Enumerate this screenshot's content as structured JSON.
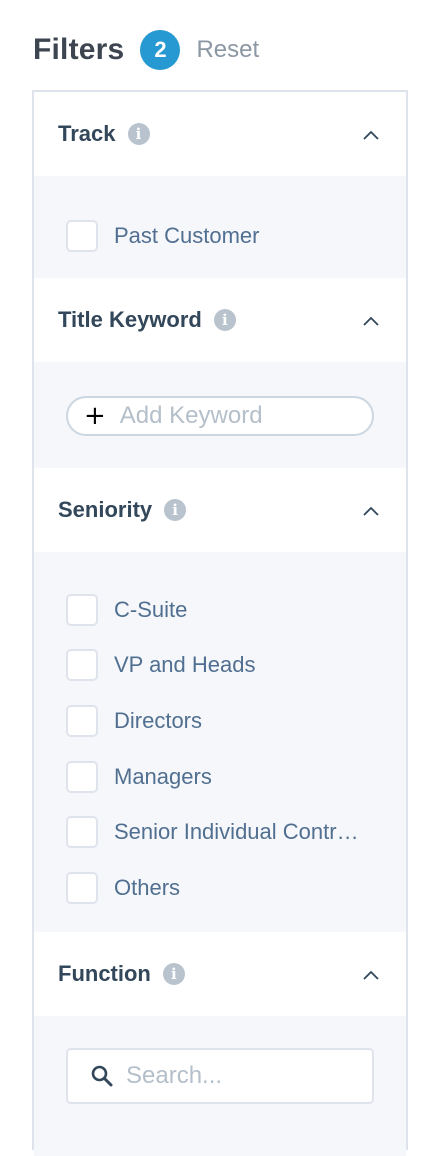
{
  "header": {
    "title": "Filters",
    "count": "2",
    "reset_label": "Reset"
  },
  "icons": {
    "info": "i"
  },
  "sections": {
    "track": {
      "label": "Track",
      "options": [
        "Past Customer"
      ]
    },
    "title_keyword": {
      "label": "Title Keyword",
      "add_symbol": "+",
      "placeholder": "Add Keyword"
    },
    "seniority": {
      "label": "Seniority",
      "options": [
        "C-Suite",
        "VP and Heads",
        "Directors",
        "Managers",
        "Senior Individual Contr…",
        "Others"
      ]
    },
    "function": {
      "label": "Function",
      "search_placeholder": "Search..."
    }
  },
  "colors": {
    "accent": "#2698d2",
    "border": "#dfe3eb",
    "body_bg": "#f5f7fa"
  }
}
